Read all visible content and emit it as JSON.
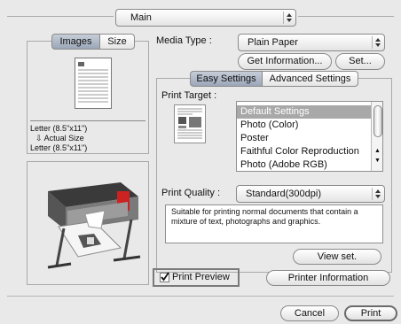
{
  "main_popup": {
    "value": "Main"
  },
  "left": {
    "tabs": [
      {
        "label": "Images"
      },
      {
        "label": "Size"
      }
    ],
    "paper_info": {
      "line1": "Letter (8.5\"x11\")",
      "line2": "Actual Size",
      "line3": "Letter (8.5\"x11\")"
    }
  },
  "media_type": {
    "label": "Media Type :",
    "value": "Plain Paper"
  },
  "buttons": {
    "get_info": "Get Information...",
    "set": "Set...",
    "view_set": "View set.",
    "printer_info": "Printer Information",
    "cancel": "Cancel",
    "print": "Print"
  },
  "settings_tabs": [
    {
      "label": "Easy Settings"
    },
    {
      "label": "Advanced Settings"
    }
  ],
  "print_target": {
    "label": "Print Target :",
    "items": [
      "Default Settings",
      "Photo (Color)",
      "Poster",
      "Faithful Color Reproduction",
      "Photo (Adobe RGB)"
    ],
    "selected_index": 0
  },
  "print_quality": {
    "label": "Print Quality :",
    "value": "Standard(300dpi)",
    "description": "Suitable for printing normal documents that contain a mixture of text, photographs and graphics."
  },
  "print_preview": {
    "label": "Print Preview",
    "checked": true
  },
  "colors": {
    "selection": "#a8a8a8",
    "highlight_frame": "#7a7a7a"
  }
}
